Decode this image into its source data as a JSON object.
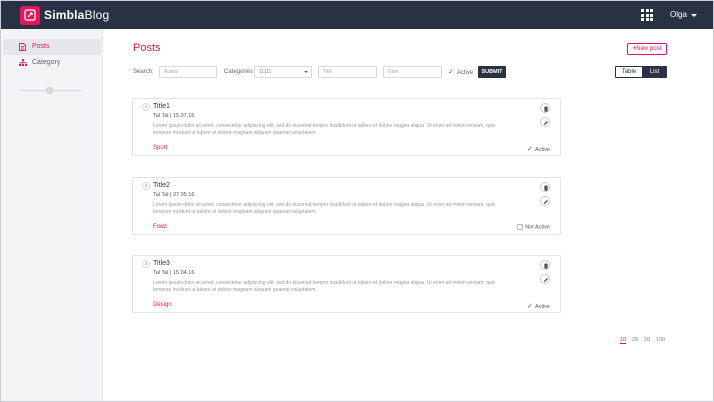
{
  "app": {
    "brand_bold": "Simbla",
    "brand_thin": "Blog"
  },
  "user": {
    "name": "Olga"
  },
  "sidebar": {
    "items": [
      {
        "label": "Posts",
        "icon": "document-icon",
        "active": true
      },
      {
        "label": "Category",
        "icon": "sitemap-icon",
        "active": false
      }
    ]
  },
  "page": {
    "title": "Posts",
    "new_post_label": "New post"
  },
  "filters": {
    "search_label": "Search:",
    "search_placeholder": "Autkw",
    "categories_label": "Categories",
    "categories_value": "11111",
    "title_placeholder": "Title",
    "date_placeholder": "Date",
    "active_label": "Active",
    "submit_label": "SUBMIT"
  },
  "view_toggle": {
    "table_label": "Table",
    "list_label": "List",
    "selected": "List"
  },
  "posts": [
    {
      "num": "1",
      "title": "Title1",
      "meta": "Tal Tal | 15.07.16",
      "desc": "Lorem ipsum dolor sit amet, consectetur adipiscing elit, sed do eiusmod tempor incididunt ut labore et dolore magna aliqua. Ut enim ad minim veniam, quis tempore incidunt ut labore et dolore magnam aliquam quaerat voluptatem.",
      "category": "Sport",
      "status": "Active",
      "active": true
    },
    {
      "num": "2",
      "title": "Title2",
      "meta": "Tal Tal | 27.05.16",
      "desc": "Lorem ipsum dolor sit amet, consectetur adipiscing elit, sed do eiusmod tempor incididunt ut labore et dolore magna aliqua. Ut enim ad minim veniam, quis tempore incidunt ut labore et dolore magnam aliquam quaerat voluptatem.",
      "category": "Food",
      "status": "Not Active",
      "active": false
    },
    {
      "num": "3",
      "title": "Title3",
      "meta": "Tal Tal | 15.04.16",
      "desc": "Lorem ipsum dolor sit amet, consectetur adipiscing elit, sed do eiusmod tempor incididunt ut labore et dolore magna aliqua. Ut enim ad minim veniam, quis tempore incidunt ut labore et dolore magnam aliquam quaerat voluptatem.",
      "category": "Design",
      "status": "Active",
      "active": true
    }
  ],
  "pagination": {
    "sizes": [
      "10",
      "25",
      "50",
      "100"
    ],
    "selected": "10"
  },
  "colors": {
    "accent": "#e3175e",
    "navy": "#293145",
    "sidebar_bg": "#f3f4f6"
  }
}
